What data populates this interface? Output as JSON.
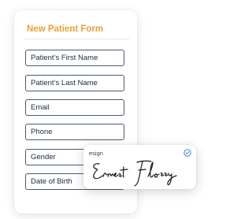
{
  "form": {
    "title": "New Patient Form",
    "fields": [
      {
        "placeholder": "Patient’s First Name"
      },
      {
        "placeholder": "Patient’s Last Name"
      },
      {
        "placeholder": "Email"
      },
      {
        "placeholder": "Phone"
      },
      {
        "placeholder": "Gender"
      },
      {
        "placeholder": "Date of Birth"
      }
    ]
  },
  "esign": {
    "label": "esign",
    "signature_text": "Ernest Flossy",
    "check_icon": "check-circle-icon"
  },
  "colors": {
    "accent": "#f0a035",
    "field_border": "#4d5a68",
    "check": "#3b8bd9"
  }
}
